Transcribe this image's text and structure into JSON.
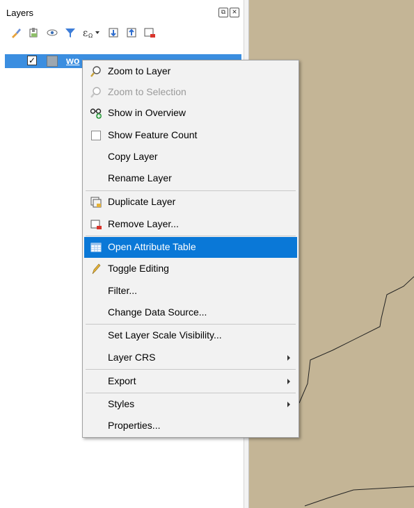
{
  "panel": {
    "title": "Layers",
    "float_label": "⧉",
    "close_label": "✕"
  },
  "layer": {
    "name": "wo",
    "checked_mark": "✓"
  },
  "menu": {
    "items": [
      {
        "label": "Zoom to Layer",
        "icon": "zoom-layer-icon"
      },
      {
        "label": "Zoom to Selection",
        "icon": "zoom-selection-icon",
        "disabled": true
      },
      {
        "label": "Show in Overview",
        "icon": "overview-glasses-icon"
      },
      {
        "label": "Show Feature Count",
        "icon": "checkbox"
      },
      {
        "label": "Copy Layer"
      },
      {
        "label": "Rename Layer"
      },
      {
        "label": "Duplicate Layer",
        "icon": "duplicate-layer-icon"
      },
      {
        "label": "Remove Layer...",
        "icon": "remove-layer-icon"
      },
      {
        "label": "Open Attribute Table",
        "icon": "attribute-table-icon",
        "highlighted": true
      },
      {
        "label": "Toggle Editing",
        "icon": "pencil-icon"
      },
      {
        "label": "Filter..."
      },
      {
        "label": "Change Data Source..."
      },
      {
        "label": "Set Layer Scale Visibility..."
      },
      {
        "label": "Layer CRS",
        "submenu": true
      },
      {
        "label": "Export",
        "submenu": true
      },
      {
        "label": "Styles",
        "submenu": true
      },
      {
        "label": "Properties..."
      }
    ]
  },
  "colors": {
    "selection": "#0a78d7",
    "layer_row": "#3b8ee0",
    "map_fill": "#c4b596"
  }
}
